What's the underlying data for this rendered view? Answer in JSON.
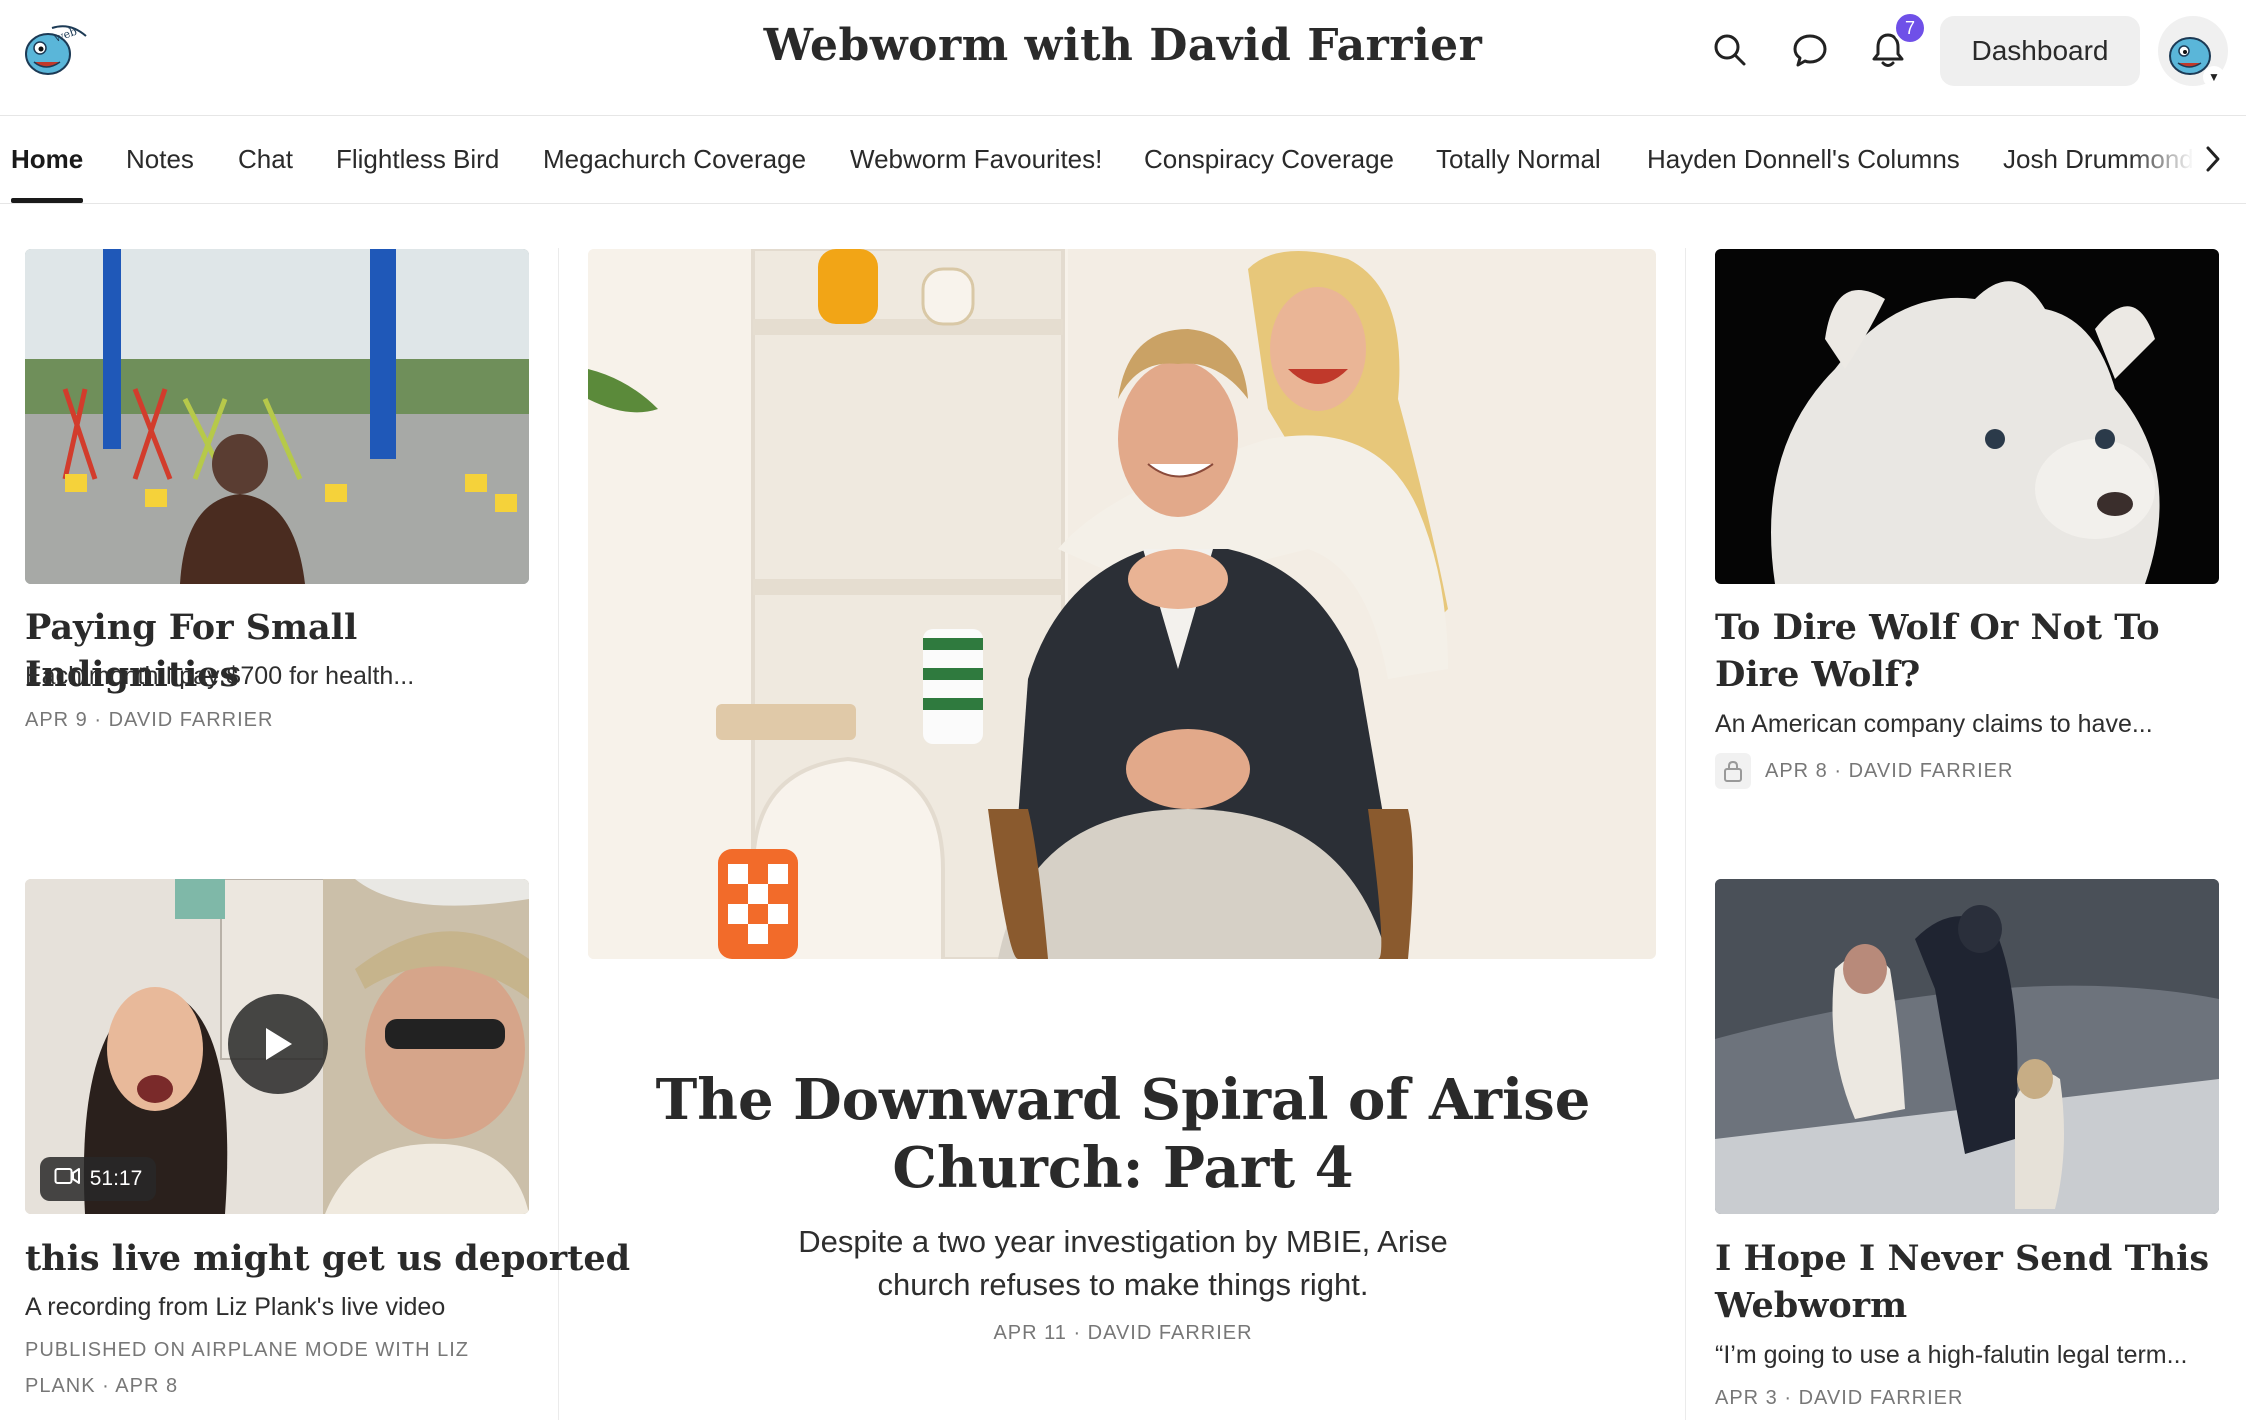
{
  "header": {
    "title": "Webworm with David Farrier",
    "notification_count": "7",
    "dashboard_label": "Dashboard",
    "logo_icon": "webworm-logo",
    "search_icon": "search-icon",
    "chat_icon": "chat-bubble-icon",
    "bell_icon": "bell-icon"
  },
  "nav": {
    "tabs": [
      {
        "label": "Home"
      },
      {
        "label": "Notes"
      },
      {
        "label": "Chat"
      },
      {
        "label": "Flightless Bird"
      },
      {
        "label": "Megachurch Coverage"
      },
      {
        "label": "Webworm Favourites!"
      },
      {
        "label": "Conspiracy Coverage"
      },
      {
        "label": "Totally Normal"
      },
      {
        "label": "Hayden Donnell's Columns"
      },
      {
        "label": "Josh Drummond's"
      }
    ]
  },
  "posts": {
    "left_top": {
      "title": "Paying For Small Indignities",
      "subtitle": "Each month I pay $700 for health...",
      "date": "APR 9",
      "author": "DAVID FARRIER"
    },
    "left_bottom": {
      "title": "this live might get us deported",
      "subtitle": "A recording from Liz Plank's live video",
      "meta_line1": "PUBLISHED ON AIRPLANE MODE WITH LIZ",
      "meta_line2": "PLANK",
      "date": "APR 8",
      "duration": "51:17"
    },
    "featured": {
      "title": "The Downward Spiral of Arise Church: Part 4",
      "subtitle": "Despite a two year investigation by MBIE, Arise church refuses to make things right.",
      "date": "APR 11",
      "author": "DAVID FARRIER"
    },
    "right_top": {
      "title": "To Dire Wolf Or Not To Dire Wolf?",
      "subtitle": "An American company claims to have...",
      "date": "APR 8",
      "author": "DAVID FARRIER",
      "locked": true
    },
    "right_bottom": {
      "title": "I Hope I Never Send This Webworm",
      "subtitle": "“I’m going to use a high-falutin legal term...",
      "date": "APR 3",
      "author": "DAVID FARRIER"
    }
  },
  "colors": {
    "accent_badge": "#6f50e8",
    "text": "#2a2a2a",
    "meta": "#777777"
  }
}
